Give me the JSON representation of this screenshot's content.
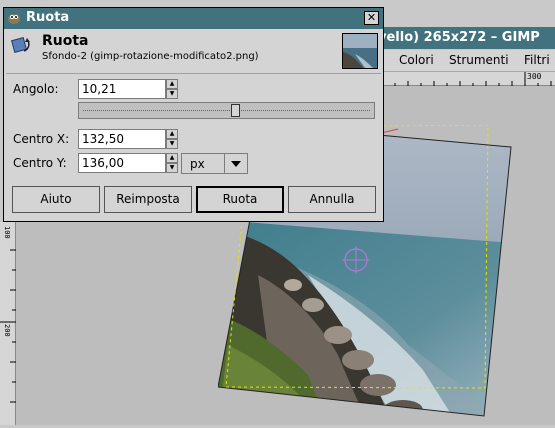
{
  "dialog": {
    "title": "Ruota",
    "close_symbol": "✕",
    "header_title": "Ruota",
    "header_subtitle": "Sfondo-2 (gimp-rotazione-modificato2.png)",
    "fields": {
      "angle_label": "Angolo:",
      "angle_value": "10,21",
      "angle_slider_fraction": 0.53,
      "center_x_label": "Centro X:",
      "center_x_value": "132,50",
      "center_y_label": "Centro Y:",
      "center_y_value": "136,00",
      "unit": "px"
    },
    "buttons": {
      "help": "Aiuto",
      "reset": "Reimposta",
      "rotate": "Ruota",
      "cancel": "Annulla"
    },
    "icons": {
      "title": "gimp-icon",
      "header": "rotate-tool-icon",
      "close": "close-icon"
    }
  },
  "gimp_window": {
    "title": "vello) 265x272 – GIMP",
    "menu": [
      "Colori",
      "Strumenti",
      "Filtri"
    ],
    "ruler_h_label": "300",
    "ruler_v_labels": [
      "100",
      "200"
    ]
  },
  "colors": {
    "titlebar": "#43727f",
    "dialog_bg": "#d4d4d4",
    "canvas": "#bdbdbd"
  }
}
